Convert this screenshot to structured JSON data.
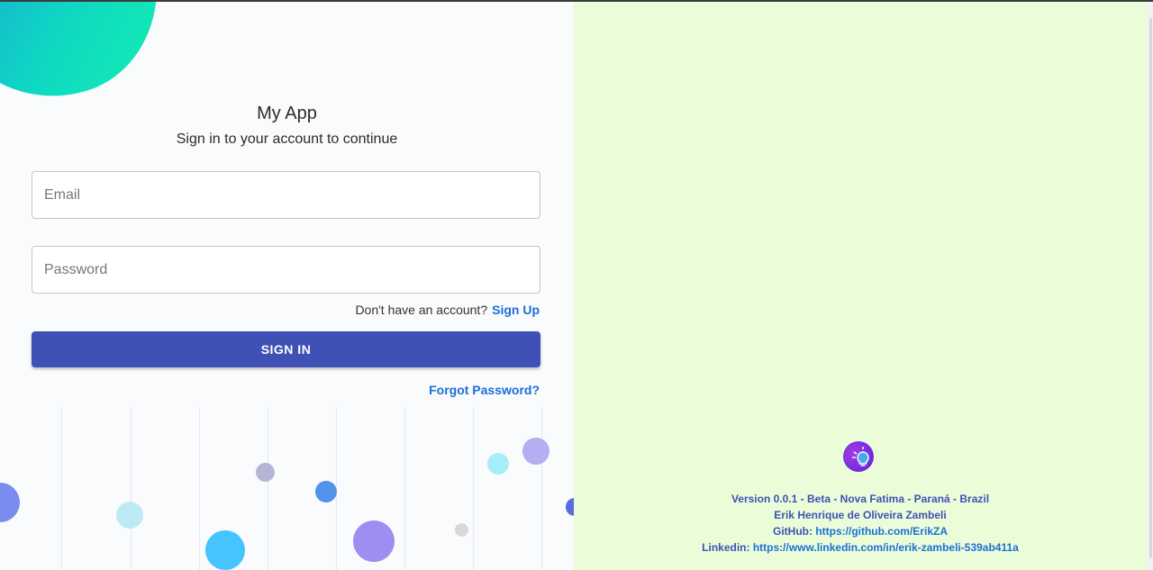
{
  "app": {
    "title": "My App",
    "subtitle": "Sign in to your account to continue"
  },
  "form": {
    "email_placeholder": "Email",
    "password_placeholder": "Password",
    "signup_prompt": "Don't have an account?",
    "signup_link": "Sign Up",
    "signin_button": "SIGN IN",
    "forgot_password": "Forgot Password?"
  },
  "footer": {
    "logo_icon": "lightbulb-gear-icon",
    "version_line": "Version 0.0.1 - Beta - Nova Fatima - Paraná - Brazil",
    "author": "Erik Henrique de Oliveira Zambeli",
    "github_label": "GitHub:",
    "github_url": "https://github.com/ErikZA",
    "linkedin_label": "Linkedin:",
    "linkedin_url": "https://www.linkedin.com/in/erik-zambeli-539ab411a"
  },
  "colors": {
    "primary": "#3f51b5",
    "link": "#1b6fd8",
    "right_panel_bg": "#ebfdd8",
    "left_panel_bg": "#f9fbfd"
  }
}
